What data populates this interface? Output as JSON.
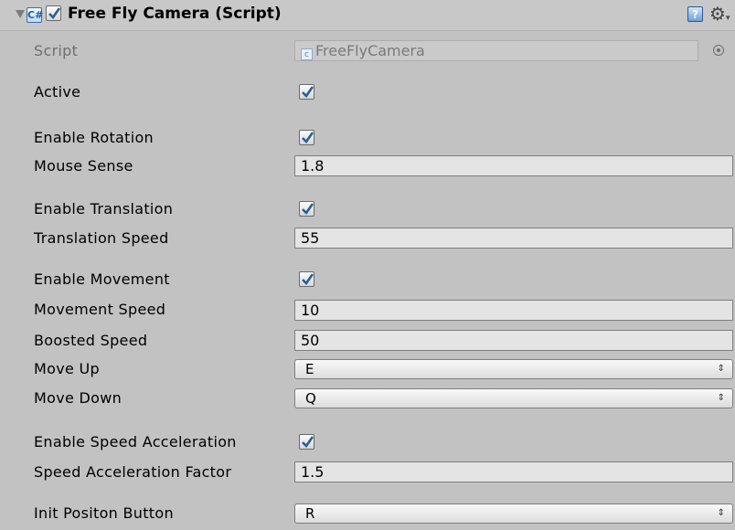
{
  "component": {
    "title": "Free Fly Camera (Script)",
    "enabled": true,
    "script_label": "Script",
    "script_value": "FreeFlyCamera"
  },
  "icons": {
    "foldout": "triangle-down-icon",
    "script": "csharp-script-icon",
    "help": "help-book-icon",
    "settings": "gear-icon",
    "object_picker": "object-picker-icon"
  },
  "fields": {
    "active": {
      "label": "Active",
      "checked": true
    },
    "enable_rotation": {
      "label": "Enable Rotation",
      "checked": true
    },
    "mouse_sense": {
      "label": "Mouse Sense",
      "value": "1.8"
    },
    "enable_translation": {
      "label": "Enable Translation",
      "checked": true
    },
    "translation_speed": {
      "label": "Translation Speed",
      "value": "55"
    },
    "enable_movement": {
      "label": "Enable Movement",
      "checked": true
    },
    "movement_speed": {
      "label": "Movement Speed",
      "value": "10"
    },
    "boosted_speed": {
      "label": "Boosted Speed",
      "value": "50"
    },
    "move_up": {
      "label": "Move Up",
      "value": "E"
    },
    "move_down": {
      "label": "Move Down",
      "value": "Q"
    },
    "enable_speed_acceleration": {
      "label": "Enable Speed Acceleration",
      "checked": true
    },
    "speed_acceleration_factor": {
      "label": "Speed Acceleration Factor",
      "value": "1.5"
    },
    "init_position_button": {
      "label": "Init Positon Button",
      "value": "R"
    }
  },
  "colors": {
    "background": "#c2c2c2",
    "field_bg": "#e4e4e4",
    "checkmark": "#2b5e94"
  }
}
